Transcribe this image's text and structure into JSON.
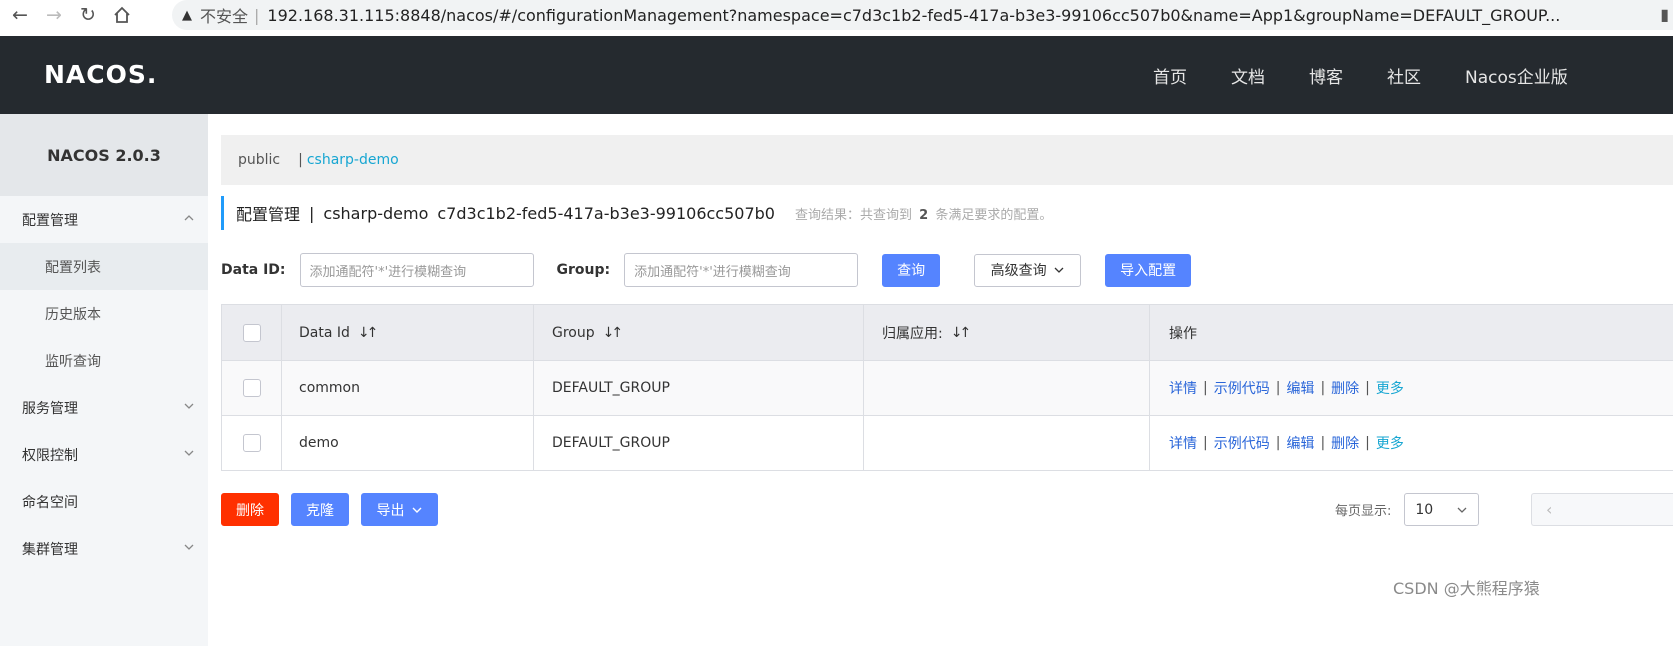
{
  "browser": {
    "insecure_label": "不安全",
    "url": "192.168.31.115:8848/nacos/#/configurationManagement?namespace=c7d3c1b2-fed5-417a-b3e3-99106cc507b0&name=App1&groupName=DEFAULT_GROUP..."
  },
  "topnav": {
    "logo": "NACOS.",
    "links": [
      "首页",
      "文档",
      "博客",
      "社区",
      "Nacos企业版"
    ]
  },
  "sidebar": {
    "title": "NACOS 2.0.3",
    "items": [
      {
        "label": "配置管理",
        "type": "group",
        "expanded": true
      },
      {
        "label": "配置列表",
        "type": "sub",
        "active": true
      },
      {
        "label": "历史版本",
        "type": "sub"
      },
      {
        "label": "监听查询",
        "type": "sub"
      },
      {
        "label": "服务管理",
        "type": "group",
        "expanded": false
      },
      {
        "label": "权限控制",
        "type": "group",
        "expanded": false
      },
      {
        "label": "命名空间",
        "type": "item"
      },
      {
        "label": "集群管理",
        "type": "group",
        "expanded": false
      }
    ]
  },
  "namespaces": {
    "items": [
      "public",
      "csharp-demo"
    ],
    "active": "csharp-demo",
    "separator": "|"
  },
  "page": {
    "title": "配置管理",
    "separator": "|",
    "namespace_name": "csharp-demo",
    "namespace_id": "c7d3c1b2-fed5-417a-b3e3-99106cc507b0",
    "result_prefix": "查询结果：共查询到",
    "result_count": "2",
    "result_suffix": "条满足要求的配置。"
  },
  "filters": {
    "data_id_label": "Data ID:",
    "data_id_placeholder": "添加通配符'*'进行模糊查询",
    "group_label": "Group:",
    "group_placeholder": "添加通配符'*'进行模糊查询",
    "search_button": "查询",
    "advanced_button": "高级查询",
    "import_button": "导入配置"
  },
  "table": {
    "columns": [
      "Data Id",
      "Group",
      "归属应用:",
      "操作"
    ],
    "rows": [
      {
        "data_id": "common",
        "group": "DEFAULT_GROUP",
        "app": ""
      },
      {
        "data_id": "demo",
        "group": "DEFAULT_GROUP",
        "app": ""
      }
    ],
    "actions": [
      "详情",
      "示例代码",
      "编辑",
      "删除",
      "更多"
    ]
  },
  "bottom": {
    "delete_button": "删除",
    "clone_button": "克隆",
    "export_button": "导出",
    "page_size_label": "每页显示:",
    "page_size": "10"
  },
  "watermark": "CSDN @大熊程序猿",
  "colors": {
    "nav_bg": "#252a2f",
    "primary": "#5584ff",
    "danger": "#ff3000",
    "link": "#2a66d9",
    "accent": "#17a6d2"
  }
}
